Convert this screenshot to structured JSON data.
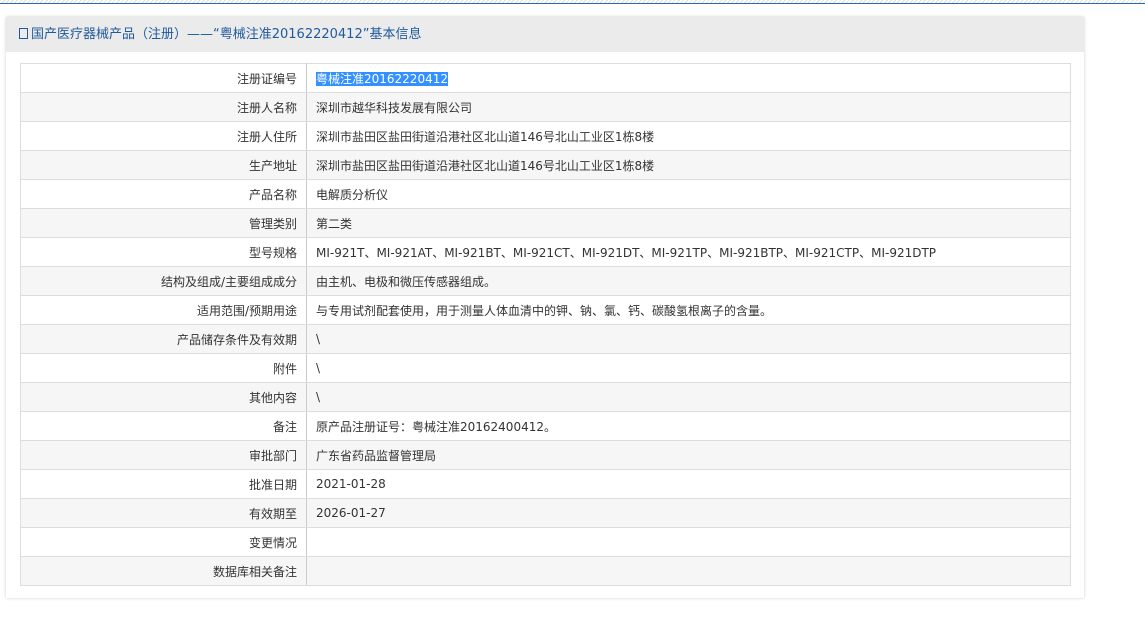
{
  "title": "国产医疗器械产品（注册）——“粤械注准20162220412”基本信息",
  "rows": [
    {
      "label": "注册证编号",
      "value": "粤械注准20162220412"
    },
    {
      "label": "注册人名称",
      "value": "深圳市越华科技发展有限公司"
    },
    {
      "label": "注册人住所",
      "value": "深圳市盐田区盐田街道沿港社区北山道146号北山工业区1栋8楼"
    },
    {
      "label": "生产地址",
      "value": "深圳市盐田区盐田街道沿港社区北山道146号北山工业区1栋8楼"
    },
    {
      "label": "产品名称",
      "value": "电解质分析仪"
    },
    {
      "label": "管理类别",
      "value": "第二类"
    },
    {
      "label": "型号规格",
      "value": "MI-921T、MI-921AT、MI-921BT、MI-921CT、MI-921DT、MI-921TP、MI-921BTP、MI-921CTP、MI-921DTP"
    },
    {
      "label": "结构及组成/主要组成成分",
      "value": "由主机、电极和微压传感器组成。"
    },
    {
      "label": "适用范围/预期用途",
      "value": "与专用试剂配套使用，用于测量人体血清中的钾、钠、氯、钙、碳酸氢根离子的含量。"
    },
    {
      "label": "产品储存条件及有效期",
      "value": "\\"
    },
    {
      "label": "附件",
      "value": "\\"
    },
    {
      "label": "其他内容",
      "value": "\\"
    },
    {
      "label": "备注",
      "value": "原产品注册证号：粤械注准20162400412。"
    },
    {
      "label": "审批部门",
      "value": "广东省药品监督管理局"
    },
    {
      "label": "批准日期",
      "value": "2021-01-28"
    },
    {
      "label": "有效期至",
      "value": "2026-01-27"
    },
    {
      "label": "变更情况",
      "value": ""
    },
    {
      "label": "数据库相关备注",
      "value": ""
    }
  ]
}
